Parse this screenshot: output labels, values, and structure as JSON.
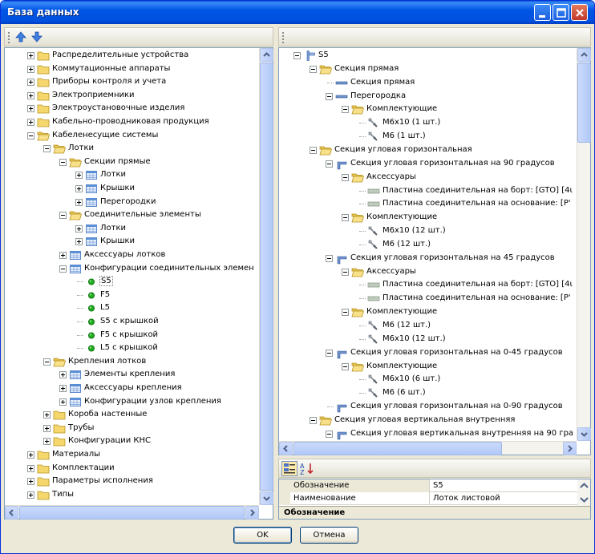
{
  "window": {
    "title": "База данных"
  },
  "left_tree": {
    "items": [
      {
        "label": "Распределительные устройства",
        "level": 0,
        "icon": "folder",
        "exp": "plus"
      },
      {
        "label": "Коммутационные аппараты",
        "level": 0,
        "icon": "folder",
        "exp": "plus"
      },
      {
        "label": "Приборы контроля и учета",
        "level": 0,
        "icon": "folder",
        "exp": "plus"
      },
      {
        "label": "Электроприемники",
        "level": 0,
        "icon": "folder",
        "exp": "plus"
      },
      {
        "label": "Электроустановочные изделия",
        "level": 0,
        "icon": "folder",
        "exp": "plus"
      },
      {
        "label": "Кабельно-проводниковая продукция",
        "level": 0,
        "icon": "folder",
        "exp": "plus"
      },
      {
        "label": "Кабеленесущие системы",
        "level": 0,
        "icon": "folder-open",
        "exp": "minus"
      },
      {
        "label": "Лотки",
        "level": 1,
        "icon": "folder-open",
        "exp": "minus"
      },
      {
        "label": "Секции прямые",
        "level": 2,
        "icon": "folder-open",
        "exp": "minus"
      },
      {
        "label": "Лотки",
        "level": 3,
        "icon": "table",
        "exp": "plus"
      },
      {
        "label": "Крышки",
        "level": 3,
        "icon": "table",
        "exp": "plus"
      },
      {
        "label": "Перегородки",
        "level": 3,
        "icon": "table",
        "exp": "plus"
      },
      {
        "label": "Соединительные элементы",
        "level": 2,
        "icon": "folder-open",
        "exp": "minus"
      },
      {
        "label": "Лотки",
        "level": 3,
        "icon": "table",
        "exp": "plus"
      },
      {
        "label": "Крышки",
        "level": 3,
        "icon": "table",
        "exp": "plus"
      },
      {
        "label": "Аксессуары лотков",
        "level": 2,
        "icon": "table",
        "exp": "plus"
      },
      {
        "label": "Конфигурации соединительных элемен",
        "level": 2,
        "icon": "table",
        "exp": "minus"
      },
      {
        "label": "S5",
        "level": 3,
        "icon": "dot",
        "exp": "none",
        "selected": true
      },
      {
        "label": "F5",
        "level": 3,
        "icon": "dot",
        "exp": "none"
      },
      {
        "label": "L5",
        "level": 3,
        "icon": "dot",
        "exp": "none"
      },
      {
        "label": "S5  с крышкой",
        "level": 3,
        "icon": "dot",
        "exp": "none"
      },
      {
        "label": "F5 с крышкой",
        "level": 3,
        "icon": "dot",
        "exp": "none"
      },
      {
        "label": "L5 с крышкой",
        "level": 3,
        "icon": "dot",
        "exp": "none"
      },
      {
        "label": "Крепления лотков",
        "level": 1,
        "icon": "folder-open",
        "exp": "minus"
      },
      {
        "label": "Элементы крепления",
        "level": 2,
        "icon": "table",
        "exp": "plus"
      },
      {
        "label": "Аксессуары крепления",
        "level": 2,
        "icon": "table",
        "exp": "plus"
      },
      {
        "label": "Конфигурации узлов крепления",
        "level": 2,
        "icon": "table",
        "exp": "plus"
      },
      {
        "label": "Короба настенные",
        "level": 1,
        "icon": "folder",
        "exp": "plus"
      },
      {
        "label": "Трубы",
        "level": 1,
        "icon": "folder",
        "exp": "plus"
      },
      {
        "label": "Конфигурации КНС",
        "level": 1,
        "icon": "folder",
        "exp": "plus"
      },
      {
        "label": "Материалы",
        "level": 0,
        "icon": "folder",
        "exp": "plus"
      },
      {
        "label": "Комплектации",
        "level": 0,
        "icon": "folder",
        "exp": "plus"
      },
      {
        "label": "Параметры исполнения",
        "level": 0,
        "icon": "folder",
        "exp": "plus"
      },
      {
        "label": "Типы",
        "level": 0,
        "icon": "folder",
        "exp": "plus"
      }
    ]
  },
  "right_tree": {
    "items": [
      {
        "label": "S5",
        "level": 0,
        "icon": "config",
        "exp": "minus"
      },
      {
        "label": "Секция прямая",
        "level": 1,
        "icon": "folder-open",
        "exp": "minus"
      },
      {
        "label": "Секция прямая",
        "level": 2,
        "icon": "bar",
        "exp": "none"
      },
      {
        "label": "Перегородка",
        "level": 2,
        "icon": "bar",
        "exp": "minus"
      },
      {
        "label": "Комплектующие",
        "level": 3,
        "icon": "folder-open",
        "exp": "minus"
      },
      {
        "label": "M6x10 (1 шт.)",
        "level": 4,
        "icon": "bolt",
        "exp": "none"
      },
      {
        "label": "M6 (1 шт.)",
        "level": 4,
        "icon": "bolt",
        "exp": "none"
      },
      {
        "label": "Секция угловая горизонтальная",
        "level": 1,
        "icon": "folder-open",
        "exp": "minus"
      },
      {
        "label": "Секция угловая горизонтальная на 90 градусов",
        "level": 2,
        "icon": "corner",
        "exp": "minus"
      },
      {
        "label": "Аксессуары",
        "level": 3,
        "icon": "folder-open",
        "exp": "minus"
      },
      {
        "label": "Пластина соединительная на борт: [GTO] [4ι",
        "level": 4,
        "icon": "plate",
        "exp": "none"
      },
      {
        "label": "Пластина соединительная на основание: [P'",
        "level": 4,
        "icon": "plate",
        "exp": "none"
      },
      {
        "label": "Комплектующие",
        "level": 3,
        "icon": "folder-open",
        "exp": "minus"
      },
      {
        "label": "M6x10 (12 шт.)",
        "level": 4,
        "icon": "bolt",
        "exp": "none"
      },
      {
        "label": "M6 (12 шт.)",
        "level": 4,
        "icon": "bolt",
        "exp": "none"
      },
      {
        "label": "Секция угловая горизонтальная на 45 градусов",
        "level": 2,
        "icon": "corner",
        "exp": "minus"
      },
      {
        "label": "Аксессуары",
        "level": 3,
        "icon": "folder-open",
        "exp": "minus"
      },
      {
        "label": "Пластина соединительная на борт: [GTO] [4ι",
        "level": 4,
        "icon": "plate",
        "exp": "none"
      },
      {
        "label": "Пластина соединительная на основание: [P'",
        "level": 4,
        "icon": "plate",
        "exp": "none"
      },
      {
        "label": "Комплектующие",
        "level": 3,
        "icon": "folder-open",
        "exp": "minus"
      },
      {
        "label": "M6 (12 шт.)",
        "level": 4,
        "icon": "bolt",
        "exp": "none"
      },
      {
        "label": "M6x10 (12 шт.)",
        "level": 4,
        "icon": "bolt",
        "exp": "none"
      },
      {
        "label": "Секция угловая горизонтальная на 0-45 градусов",
        "level": 2,
        "icon": "corner",
        "exp": "minus"
      },
      {
        "label": "Комплектующие",
        "level": 3,
        "icon": "folder-open",
        "exp": "minus"
      },
      {
        "label": "M6x10 (6 шт.)",
        "level": 4,
        "icon": "bolt",
        "exp": "none"
      },
      {
        "label": "M6 (6 шт.)",
        "level": 4,
        "icon": "bolt",
        "exp": "none"
      },
      {
        "label": "Секция угловая горизонтальная на 0-90 градусов",
        "level": 2,
        "icon": "corner",
        "exp": "none"
      },
      {
        "label": "Секция угловая вертикальная внутренняя",
        "level": 1,
        "icon": "folder-open",
        "exp": "minus"
      },
      {
        "label": "Секция угловая вертикальная внутренняя на 90 гра",
        "level": 2,
        "icon": "corner",
        "exp": "minus"
      }
    ]
  },
  "properties": {
    "rows": [
      {
        "name": "Обозначение",
        "value": "S5"
      },
      {
        "name": "Наименование",
        "value": "Лоток листовой"
      }
    ],
    "description_title": "Обозначение"
  },
  "buttons": {
    "ok": "OK",
    "cancel": "Отмена"
  },
  "colors": {
    "title": "#0055e5",
    "folder": "#f5d76e",
    "dot": "#1ea81e",
    "table": "#5b8fd6"
  }
}
